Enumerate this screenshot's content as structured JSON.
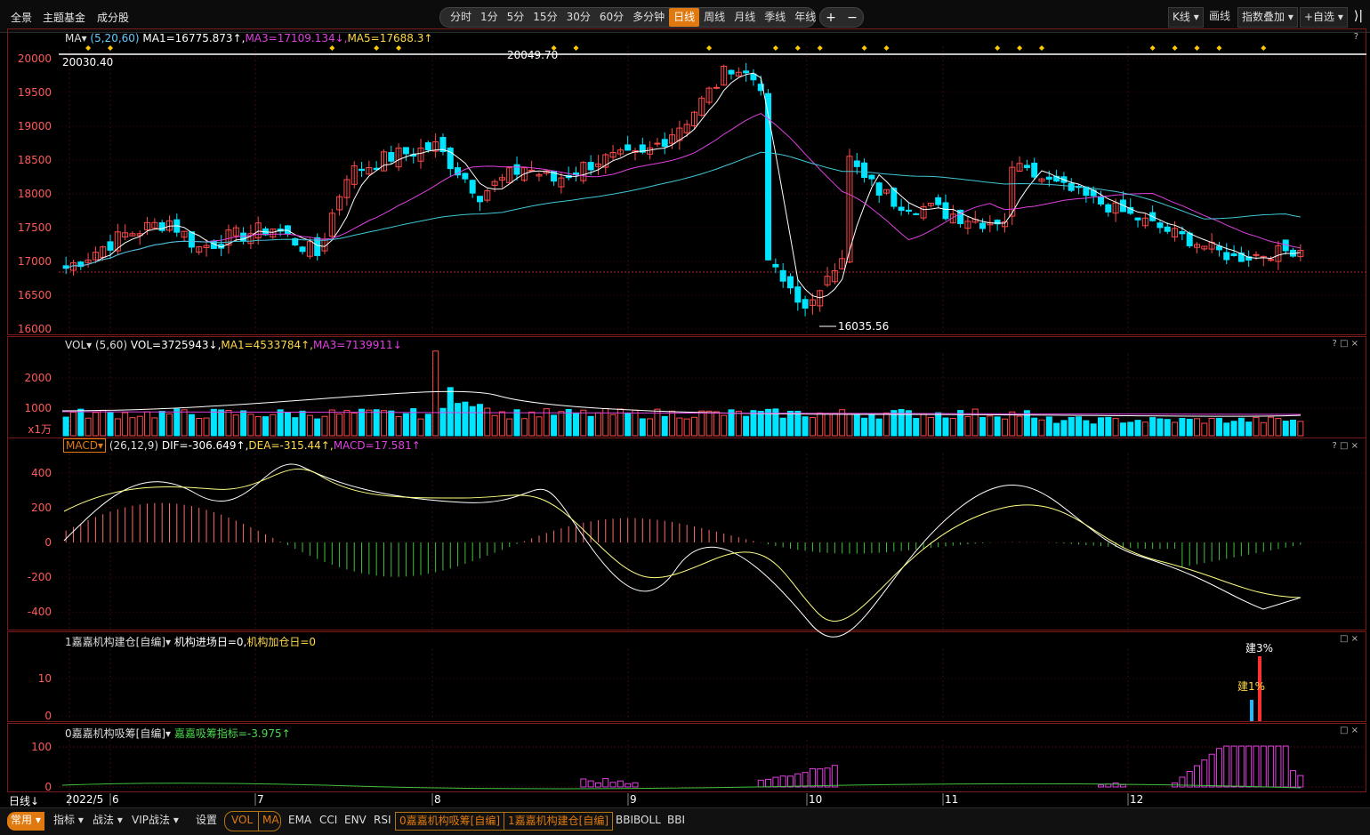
{
  "top_nav": [
    "全景",
    "主题基金",
    "成分股"
  ],
  "periods": [
    "分时",
    "1分",
    "5分",
    "15分",
    "30分",
    "60分",
    "多分钟",
    "日线",
    "周线",
    "月线",
    "季线",
    "年线"
  ],
  "active_period": "日线",
  "plus_minus": [
    "+",
    "−"
  ],
  "right_buttons": {
    "kline": "K线",
    "draw": "画线",
    "overlay": "指数叠加",
    "watch": "+自选"
  },
  "main": {
    "label": "MA",
    "params": "(5,20,60)",
    "ma1": "MA1=16775.873↑,",
    "ma3": "MA3=17109.134↓,",
    "ma5": "MA5=17688.3↑",
    "y_ticks": [
      "20000",
      "19500",
      "19000",
      "18500",
      "18000",
      "17500",
      "17000",
      "16500",
      "16000"
    ],
    "high_label": "20049.70",
    "low_label": "16035.56",
    "ref_label": "20030.40"
  },
  "vol": {
    "label": "VOL",
    "params": "(5,60)",
    "v": "VOL=3725943↓,",
    "ma1": "MA1=4533784↑,",
    "ma3": "MA3=7139911↓",
    "y_ticks": [
      "2000",
      "1000"
    ],
    "unit": "x1万"
  },
  "macd": {
    "label": "MACD",
    "params": "(26,12,9)",
    "dif": "DIF=-306.649↑,",
    "dea": "DEA=-315.44↑,",
    "macd": "MACD=17.581↑",
    "y_ticks": [
      "400",
      "200",
      "0",
      "-200",
      "-400"
    ]
  },
  "jc": {
    "label": "1嘉嘉机构建仓[自编]",
    "text1": "机构进场日=0,",
    "text2": "机构加仓日=0",
    "y_ticks": [
      "10",
      "0"
    ],
    "tag1": "建3%",
    "tag2": "建1%"
  },
  "xc": {
    "label": "0嘉嘉机构吸筹[自编]",
    "text": "嘉嘉吸筹指标=-3.975↑",
    "y_ticks": [
      "100",
      "0"
    ]
  },
  "panel_ctrls": {
    "help": "?",
    "max": "□",
    "close": "×"
  },
  "axis": {
    "period_label": "日线",
    "months": [
      "2022/5",
      "6",
      "7",
      "8",
      "9",
      "10",
      "11",
      "12"
    ]
  },
  "bottom": {
    "menus": [
      "常用",
      "指标",
      "战法",
      "VIP战法"
    ],
    "settings": "设置",
    "tabs": [
      "VOL",
      "MA",
      "EMA",
      "CCI",
      "ENV",
      "RSI",
      "0嘉嘉机构吸筹[自编]",
      "1嘉嘉机构建仓[自编]",
      "BBIBOLL",
      "BBI"
    ]
  },
  "colors": {
    "up": "#ff4a4a",
    "down": "#00e5ff",
    "ma1": "#ffffff",
    "ma3": "#e040e0",
    "ma5": "#40c8d8",
    "accent": "#e07a10"
  },
  "chart_data": {
    "type": "candlestick",
    "title": "",
    "x_range": [
      "2022/5",
      "12"
    ],
    "ylim": [
      16000,
      20050
    ],
    "high": 20049.7,
    "low": 16035.56,
    "ma_params": [
      5,
      20,
      60
    ]
  }
}
